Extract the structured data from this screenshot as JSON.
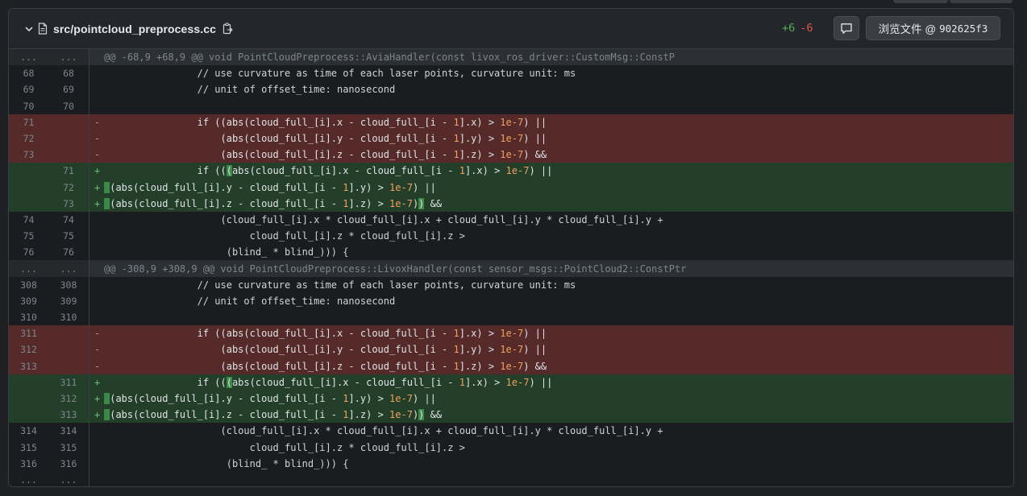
{
  "file": {
    "name": "src/pointcloud_preprocess.cc",
    "additions": "+6",
    "deletions": "-6",
    "view_label": "浏览文件 @",
    "commit": "902625f3",
    "icons": [
      "chevron-down-icon",
      "file-icon",
      "copy-icon",
      "comment-icon"
    ]
  },
  "colors": {
    "deleted_bg": "#552a29",
    "added_bg": "#233f29",
    "addition_count": "#57ab5a",
    "deletion_count": "#e5534b",
    "number_literal": "#f0a060"
  },
  "diff": [
    {
      "type": "hunk",
      "old": "...",
      "new": "...",
      "text": "@@ -68,9 +68,9 @@ void PointCloudPreprocess::AviaHandler(const livox_ros_driver::CustomMsg::ConstP"
    },
    {
      "type": "ctx",
      "old": "68",
      "new": "68",
      "sign": "",
      "text": "                // use curvature as time of each laser points, curvature unit: ms"
    },
    {
      "type": "ctx",
      "old": "69",
      "new": "69",
      "sign": "",
      "text": "                // unit of offset_time: nanosecond"
    },
    {
      "type": "ctx",
      "old": "70",
      "new": "70",
      "sign": "",
      "text": ""
    },
    {
      "type": "del",
      "old": "71",
      "new": "",
      "sign": "-",
      "text": "                if ((abs(cloud_full_[i].x - cloud_full_[i - 1].x) > 1e-7) ||"
    },
    {
      "type": "del",
      "old": "72",
      "new": "",
      "sign": "-",
      "text": "                    (abs(cloud_full_[i].y - cloud_full_[i - 1].y) > 1e-7) ||"
    },
    {
      "type": "del",
      "old": "73",
      "new": "",
      "sign": "-",
      "text": "                    (abs(cloud_full_[i].z - cloud_full_[i - 1].z) > 1e-7) &&"
    },
    {
      "type": "add",
      "old": "",
      "new": "71",
      "sign": "+",
      "text": "                if (((abs(cloud_full_[i].x - cloud_full_[i - 1].x) > 1e-7) ||"
    },
    {
      "type": "add",
      "old": "",
      "new": "72",
      "sign": "+",
      "text": "                     (abs(cloud_full_[i].y - cloud_full_[i - 1].y) > 1e-7) ||"
    },
    {
      "type": "add",
      "old": "",
      "new": "73",
      "sign": "+",
      "text": "                     (abs(cloud_full_[i].z - cloud_full_[i - 1].z) > 1e-7)) &&"
    },
    {
      "type": "ctx",
      "old": "74",
      "new": "74",
      "sign": "",
      "text": "                    (cloud_full_[i].x * cloud_full_[i].x + cloud_full_[i].y * cloud_full_[i].y +"
    },
    {
      "type": "ctx",
      "old": "75",
      "new": "75",
      "sign": "",
      "text": "                         cloud_full_[i].z * cloud_full_[i].z >"
    },
    {
      "type": "ctx",
      "old": "76",
      "new": "76",
      "sign": "",
      "text": "                     (blind_ * blind_))) {"
    },
    {
      "type": "hunk",
      "old": "...",
      "new": "...",
      "text": "@@ -308,9 +308,9 @@ void PointCloudPreprocess::LivoxHandler(const sensor_msgs::PointCloud2::ConstPtr"
    },
    {
      "type": "ctx",
      "old": "308",
      "new": "308",
      "sign": "",
      "text": "                // use curvature as time of each laser points, curvature unit: ms"
    },
    {
      "type": "ctx",
      "old": "309",
      "new": "309",
      "sign": "",
      "text": "                // unit of offset_time: nanosecond"
    },
    {
      "type": "ctx",
      "old": "310",
      "new": "310",
      "sign": "",
      "text": ""
    },
    {
      "type": "del",
      "old": "311",
      "new": "",
      "sign": "-",
      "text": "                if ((abs(cloud_full_[i].x - cloud_full_[i - 1].x) > 1e-7) ||"
    },
    {
      "type": "del",
      "old": "312",
      "new": "",
      "sign": "-",
      "text": "                    (abs(cloud_full_[i].y - cloud_full_[i - 1].y) > 1e-7) ||"
    },
    {
      "type": "del",
      "old": "313",
      "new": "",
      "sign": "-",
      "text": "                    (abs(cloud_full_[i].z - cloud_full_[i - 1].z) > 1e-7) &&"
    },
    {
      "type": "add",
      "old": "",
      "new": "311",
      "sign": "+",
      "text": "                if (((abs(cloud_full_[i].x - cloud_full_[i - 1].x) > 1e-7) ||"
    },
    {
      "type": "add",
      "old": "",
      "new": "312",
      "sign": "+",
      "text": "                     (abs(cloud_full_[i].y - cloud_full_[i - 1].y) > 1e-7) ||"
    },
    {
      "type": "add",
      "old": "",
      "new": "313",
      "sign": "+",
      "text": "                     (abs(cloud_full_[i].z - cloud_full_[i - 1].z) > 1e-7)) &&"
    },
    {
      "type": "ctx",
      "old": "314",
      "new": "314",
      "sign": "",
      "text": "                    (cloud_full_[i].x * cloud_full_[i].x + cloud_full_[i].y * cloud_full_[i].y +"
    },
    {
      "type": "ctx",
      "old": "315",
      "new": "315",
      "sign": "",
      "text": "                         cloud_full_[i].z * cloud_full_[i].z >"
    },
    {
      "type": "ctx",
      "old": "316",
      "new": "316",
      "sign": "",
      "text": "                     (blind_ * blind_))) {"
    },
    {
      "type": "ctx",
      "old": "...",
      "new": "...",
      "sign": "",
      "text": ""
    }
  ]
}
